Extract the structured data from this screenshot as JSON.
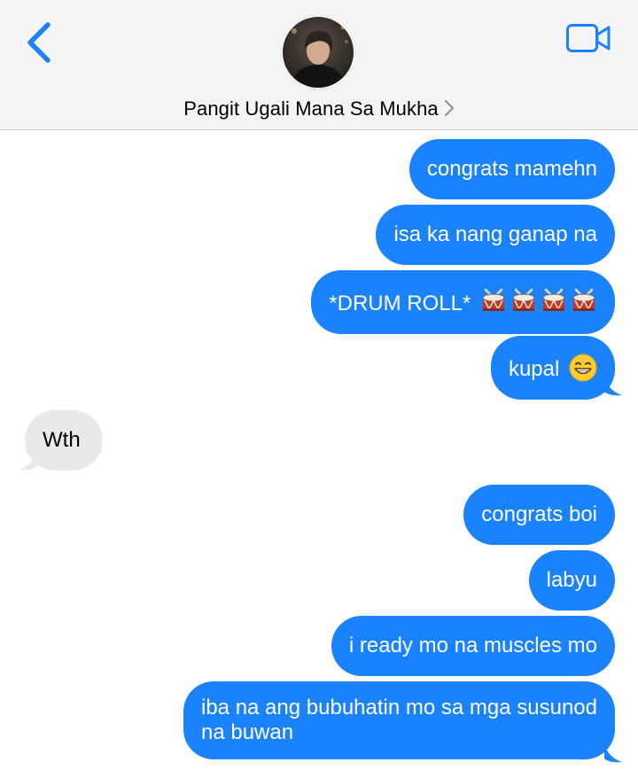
{
  "header": {
    "contact_name": "Pangit Ugali Mana Sa Mukha",
    "back_icon": "chevron-left-icon",
    "video_icon": "video-camera-icon",
    "accent_color": "#1a82fb"
  },
  "messages": [
    {
      "from": "me",
      "text": "congrats mamehn"
    },
    {
      "from": "me",
      "text": "isa ka nang ganap na"
    },
    {
      "from": "me",
      "text": "*DRUM ROLL*",
      "emoji": [
        "drum",
        "drum",
        "drum",
        "drum"
      ]
    },
    {
      "from": "me",
      "text": "kupal",
      "emoji": [
        "grinning-face"
      ]
    },
    {
      "from": "them",
      "text": "Wth"
    },
    {
      "from": "me",
      "text": "congrats boi"
    },
    {
      "from": "me",
      "text": "labyu"
    },
    {
      "from": "me",
      "text": "i ready mo na muscles mo"
    },
    {
      "from": "me",
      "text": "iba na ang bubuhatin mo sa mga susunod",
      "text_line2": "na buwan"
    }
  ],
  "colors": {
    "sent_bubble": "#1a82fb",
    "received_bubble": "#e9e9eb",
    "header_bg": "#f4f4f6"
  }
}
